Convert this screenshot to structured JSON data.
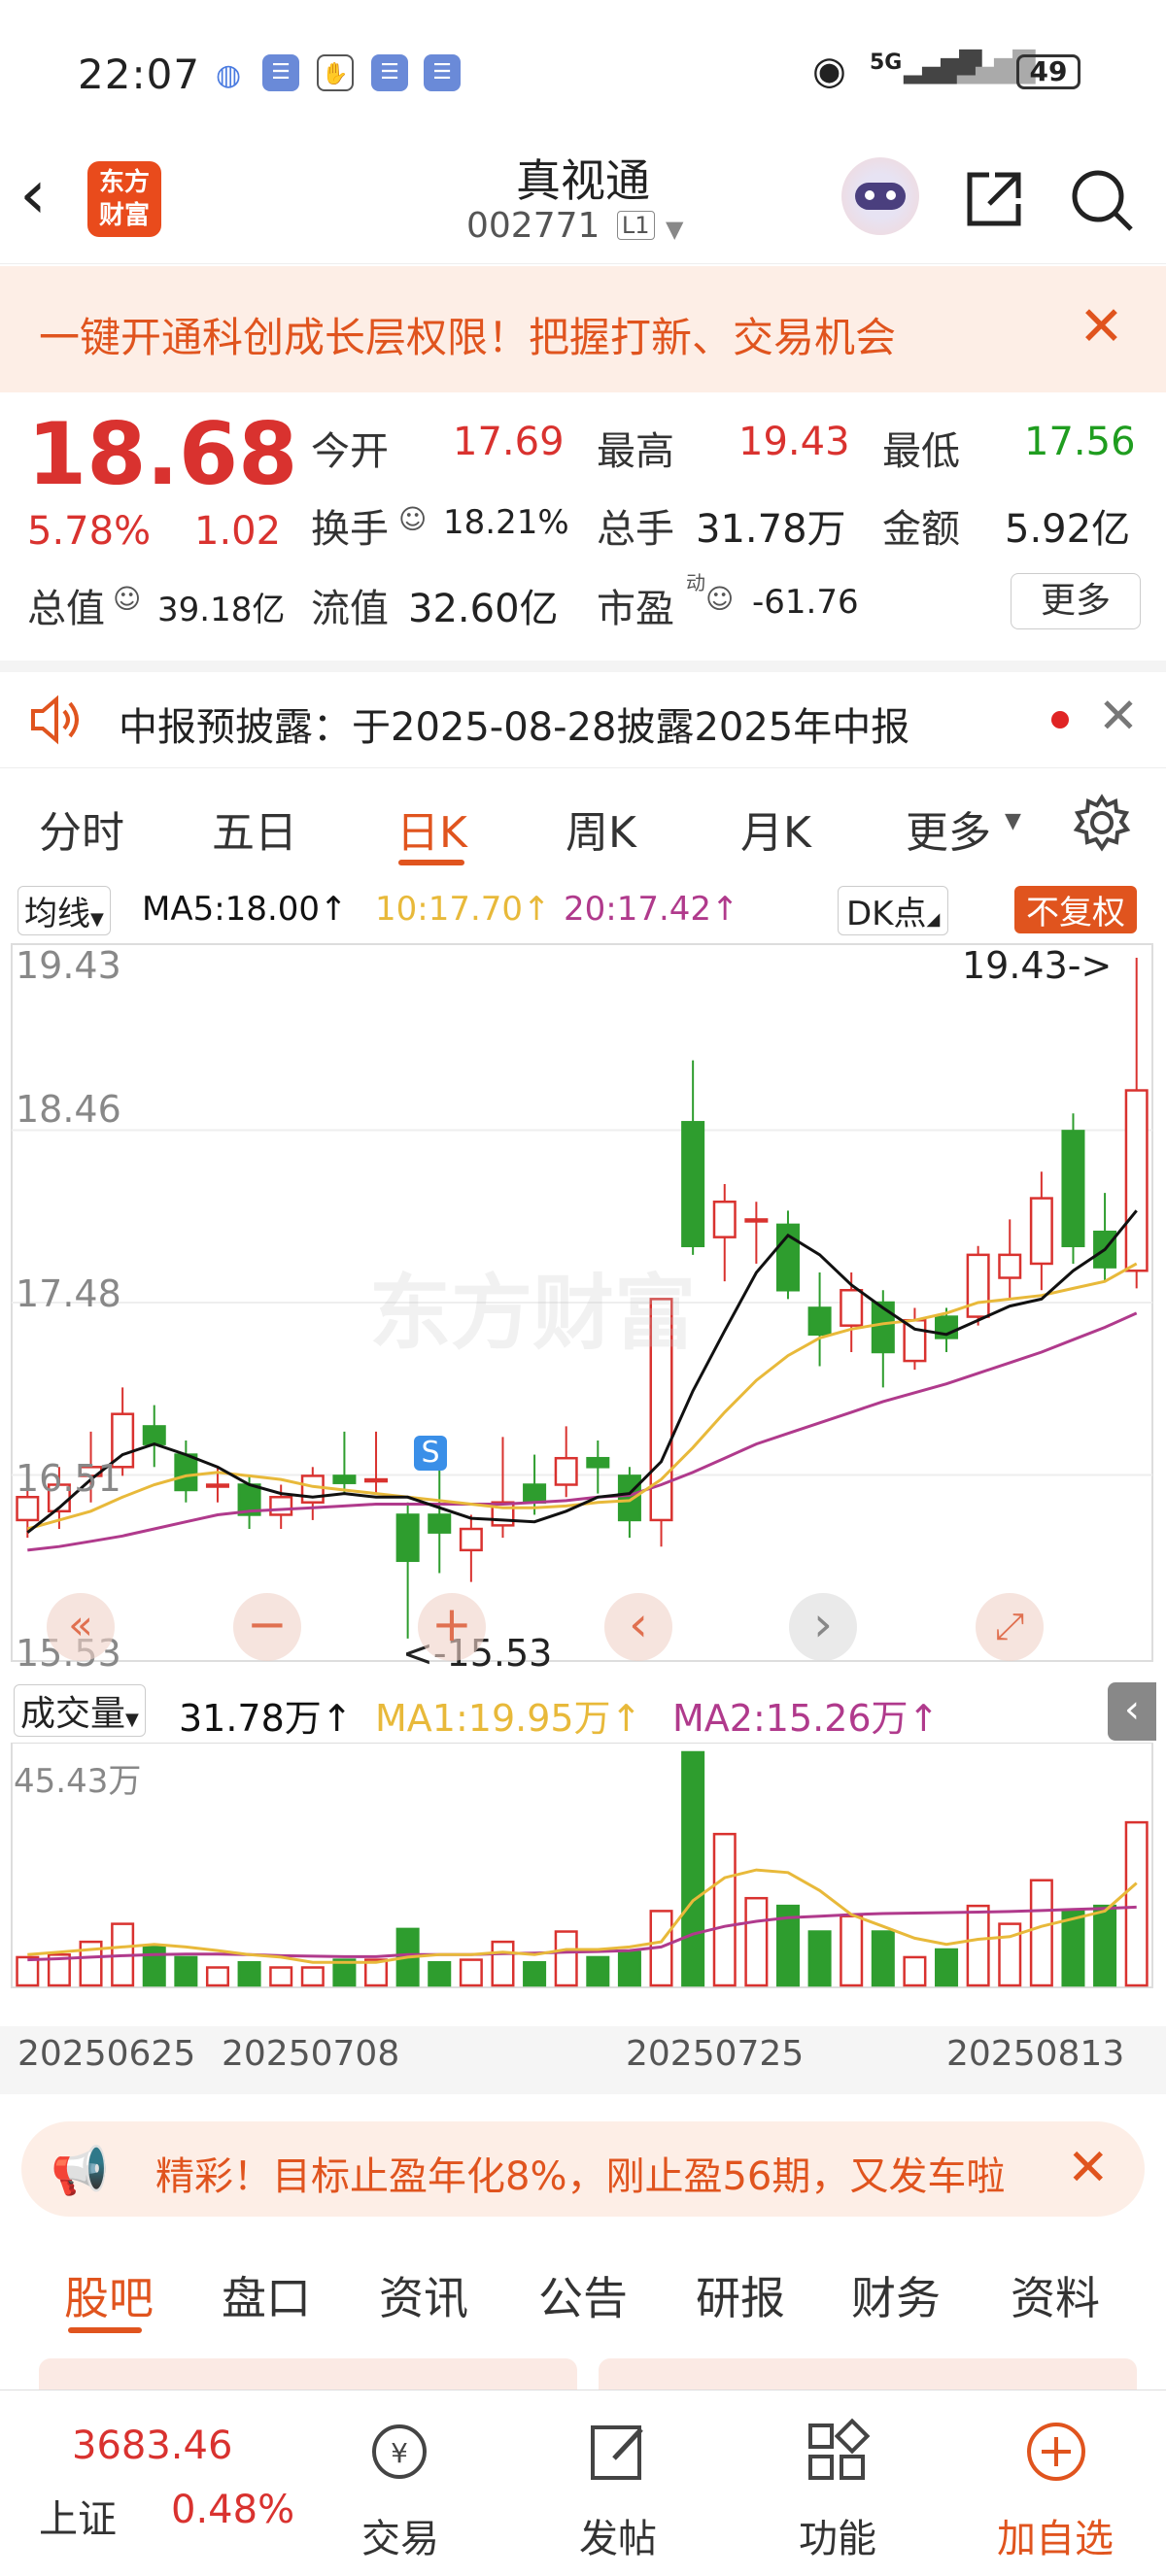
{
  "status_bar": {
    "time": "22:07",
    "network": "5G",
    "battery": "49"
  },
  "header": {
    "logo_line1": "东方",
    "logo_line2": "财富",
    "title": "真视通",
    "code": "002771",
    "level": "L1"
  },
  "banner": {
    "text": "一键开通科创成长层权限！把握打新、交易机会"
  },
  "quote": {
    "price": "18.68",
    "change_pct": "5.78%",
    "change": "1.02",
    "open_label": "今开",
    "open": "17.69",
    "high_label": "最高",
    "high": "19.43",
    "low_label": "最低",
    "low": "17.56",
    "turnover_label": "换手",
    "turnover": "18.21%",
    "volume_label": "总手",
    "volume": "31.78万",
    "amount_label": "金额",
    "amount": "5.92亿",
    "mcap_label": "总值",
    "mcap": "39.18亿",
    "float_label": "流值",
    "float": "32.60亿",
    "pe_label": "市盈",
    "pe_sup": "动",
    "pe": "-61.76",
    "more": "更多"
  },
  "notice": {
    "text": "中报预披露：于2025-08-28披露2025年中报"
  },
  "period_tabs": {
    "t1": "分时",
    "t2": "五日",
    "t3": "日K",
    "t4": "周K",
    "t5": "月K",
    "t6": "更多"
  },
  "ma_bar": {
    "type": "均线",
    "ma5": "MA5:18.00↑",
    "ma10": "10:17.70↑",
    "ma20": "20:17.42↑",
    "dk": "DK点",
    "adjust": "不复权"
  },
  "price_axis": {
    "p1": "19.43",
    "p2": "18.46",
    "p3": "17.48",
    "p4": "16.51",
    "p5": "15.53"
  },
  "annotations": {
    "high_marker": "19.43->",
    "low_marker": "<-15.53",
    "s_marker": "S"
  },
  "volume_bar": {
    "type": "成交量",
    "vol": "31.78万↑",
    "ma1": "MA1:19.95万↑",
    "ma2": "MA2:15.26万↑",
    "axis_max": "45.43万"
  },
  "dates": {
    "d1": "20250625",
    "d2": "20250708",
    "d3": "20250725",
    "d4": "20250813"
  },
  "promo": {
    "text": "精彩！目标止盈年化8%，刚止盈56期，又发车啦"
  },
  "sub_tabs": {
    "t1": "股吧",
    "t2": "盘口",
    "t3": "资讯",
    "t4": "公告",
    "t5": "研报",
    "t6": "财务",
    "t7": "资料"
  },
  "bottom": {
    "index_value": "3683.46",
    "index_name": "上证",
    "index_pct": "0.48%",
    "trade": "交易",
    "post": "发帖",
    "func": "功能",
    "watch": "加自选"
  },
  "colors": {
    "up": "#d9322f",
    "down": "#2e9d2e",
    "accent": "#e0541e",
    "ma5": "#111111",
    "ma10": "#e8b93a",
    "ma20": "#b03a8c"
  },
  "chart_data": {
    "type": "candlestick",
    "price_range": [
      15.53,
      19.43
    ],
    "candles": [
      {
        "o": 16.25,
        "c": 16.38,
        "h": 16.45,
        "l": 16.15
      },
      {
        "o": 16.3,
        "c": 16.45,
        "h": 16.55,
        "l": 16.2
      },
      {
        "o": 16.5,
        "c": 16.55,
        "h": 16.75,
        "l": 16.35
      },
      {
        "o": 16.55,
        "c": 16.85,
        "h": 17.0,
        "l": 16.5
      },
      {
        "o": 16.78,
        "c": 16.68,
        "h": 16.9,
        "l": 16.55
      },
      {
        "o": 16.62,
        "c": 16.42,
        "h": 16.7,
        "l": 16.35
      },
      {
        "o": 16.45,
        "c": 16.45,
        "h": 16.55,
        "l": 16.35
      },
      {
        "o": 16.45,
        "c": 16.28,
        "h": 16.5,
        "l": 16.2
      },
      {
        "o": 16.28,
        "c": 16.38,
        "h": 16.45,
        "l": 16.2
      },
      {
        "o": 16.35,
        "c": 16.5,
        "h": 16.55,
        "l": 16.25
      },
      {
        "o": 16.5,
        "c": 16.46,
        "h": 16.75,
        "l": 16.4
      },
      {
        "o": 16.48,
        "c": 16.48,
        "h": 16.75,
        "l": 16.4
      },
      {
        "o": 16.28,
        "c": 16.02,
        "h": 16.35,
        "l": 15.58
      },
      {
        "o": 16.28,
        "c": 16.18,
        "h": 16.7,
        "l": 15.95
      },
      {
        "o": 16.08,
        "c": 16.2,
        "h": 16.28,
        "l": 15.9
      },
      {
        "o": 16.22,
        "c": 16.35,
        "h": 16.72,
        "l": 16.15
      },
      {
        "o": 16.45,
        "c": 16.35,
        "h": 16.62,
        "l": 16.28
      },
      {
        "o": 16.45,
        "c": 16.6,
        "h": 16.78,
        "l": 16.38
      },
      {
        "o": 16.6,
        "c": 16.55,
        "h": 16.7,
        "l": 16.4
      },
      {
        "o": 16.5,
        "c": 16.25,
        "h": 16.55,
        "l": 16.15
      },
      {
        "o": 16.25,
        "c": 17.5,
        "h": 17.5,
        "l": 16.1
      },
      {
        "o": 18.5,
        "c": 17.8,
        "h": 18.85,
        "l": 17.75
      },
      {
        "o": 17.85,
        "c": 18.05,
        "h": 18.15,
        "l": 17.6
      },
      {
        "o": 17.95,
        "c": 17.95,
        "h": 18.05,
        "l": 17.7
      },
      {
        "o": 17.92,
        "c": 17.55,
        "h": 18.0,
        "l": 17.5
      },
      {
        "o": 17.45,
        "c": 17.3,
        "h": 17.65,
        "l": 17.12
      },
      {
        "o": 17.35,
        "c": 17.55,
        "h": 17.65,
        "l": 17.2
      },
      {
        "o": 17.48,
        "c": 17.2,
        "h": 17.55,
        "l": 17.0
      },
      {
        "o": 17.15,
        "c": 17.38,
        "h": 17.45,
        "l": 17.1
      },
      {
        "o": 17.4,
        "c": 17.28,
        "h": 17.45,
        "l": 17.2
      },
      {
        "o": 17.4,
        "c": 17.75,
        "h": 17.8,
        "l": 17.35
      },
      {
        "o": 17.62,
        "c": 17.75,
        "h": 17.95,
        "l": 17.5
      },
      {
        "o": 17.7,
        "c": 18.07,
        "h": 18.22,
        "l": 17.55
      },
      {
        "o": 18.45,
        "c": 17.8,
        "h": 18.55,
        "l": 17.7
      },
      {
        "o": 17.88,
        "c": 17.68,
        "h": 18.1,
        "l": 17.6
      },
      {
        "o": 17.66,
        "c": 18.68,
        "h": 19.43,
        "l": 17.56
      }
    ],
    "ma5": [
      16.18,
      16.32,
      16.48,
      16.62,
      16.68,
      16.62,
      16.55,
      16.45,
      16.4,
      16.38,
      16.4,
      16.38,
      16.38,
      16.32,
      16.26,
      16.25,
      16.24,
      16.3,
      16.38,
      16.4,
      16.58,
      16.98,
      17.32,
      17.65,
      17.86,
      17.75,
      17.58,
      17.45,
      17.33,
      17.3,
      17.38,
      17.46,
      17.5,
      17.66,
      17.78,
      18.0
    ],
    "ma10": [
      16.2,
      16.25,
      16.3,
      16.38,
      16.45,
      16.5,
      16.52,
      16.5,
      16.48,
      16.44,
      16.42,
      16.4,
      16.38,
      16.36,
      16.34,
      16.32,
      16.32,
      16.33,
      16.35,
      16.36,
      16.48,
      16.66,
      16.86,
      17.04,
      17.18,
      17.28,
      17.33,
      17.36,
      17.38,
      17.42,
      17.48,
      17.5,
      17.52,
      17.56,
      17.6,
      17.7
    ],
    "ma20": [
      16.08,
      16.1,
      16.13,
      16.16,
      16.2,
      16.24,
      16.28,
      16.3,
      16.31,
      16.32,
      16.33,
      16.34,
      16.34,
      16.34,
      16.34,
      16.34,
      16.35,
      16.36,
      16.38,
      16.39,
      16.45,
      16.52,
      16.6,
      16.68,
      16.74,
      16.8,
      16.86,
      16.92,
      16.97,
      17.02,
      17.08,
      17.14,
      17.2,
      17.27,
      17.34,
      17.42
    ],
    "volume_range": [
      0,
      45.43
    ],
    "volumes": [
      5.5,
      6.0,
      8.5,
      12.0,
      7.5,
      5.5,
      3.5,
      4.5,
      3.5,
      3.5,
      5.0,
      5.0,
      11.0,
      4.5,
      5.0,
      8.5,
      4.5,
      10.5,
      5.5,
      6.5,
      14.5,
      45.43,
      29.5,
      17.0,
      15.5,
      10.5,
      13.5,
      10.5,
      5.5,
      7.0,
      15.5,
      12.0,
      20.5,
      14.5,
      15.5,
      31.78
    ],
    "vol_ma1": [
      6.0,
      6.5,
      7.0,
      7.5,
      8.0,
      7.5,
      6.8,
      6.0,
      5.5,
      4.5,
      4.5,
      4.5,
      5.5,
      6.0,
      6.0,
      6.5,
      6.0,
      7.0,
      7.0,
      7.5,
      8.5,
      16.5,
      21.0,
      22.5,
      22.0,
      18.5,
      13.8,
      11.5,
      9.2,
      8.0,
      9.0,
      9.5,
      11.5,
      13.0,
      14.5,
      19.95
    ],
    "vol_ma2": [
      5.0,
      5.2,
      5.5,
      5.8,
      6.0,
      6.1,
      6.1,
      6.0,
      5.8,
      5.7,
      5.6,
      5.6,
      6.0,
      6.0,
      6.0,
      6.2,
      6.3,
      6.5,
      6.6,
      6.8,
      7.5,
      10.0,
      11.5,
      12.5,
      13.2,
      13.5,
      13.8,
      14.0,
      14.1,
      14.2,
      14.3,
      14.4,
      14.6,
      14.8,
      15.0,
      15.26
    ],
    "dates": [
      "20250625",
      "20250708",
      "20250725",
      "20250813"
    ]
  }
}
